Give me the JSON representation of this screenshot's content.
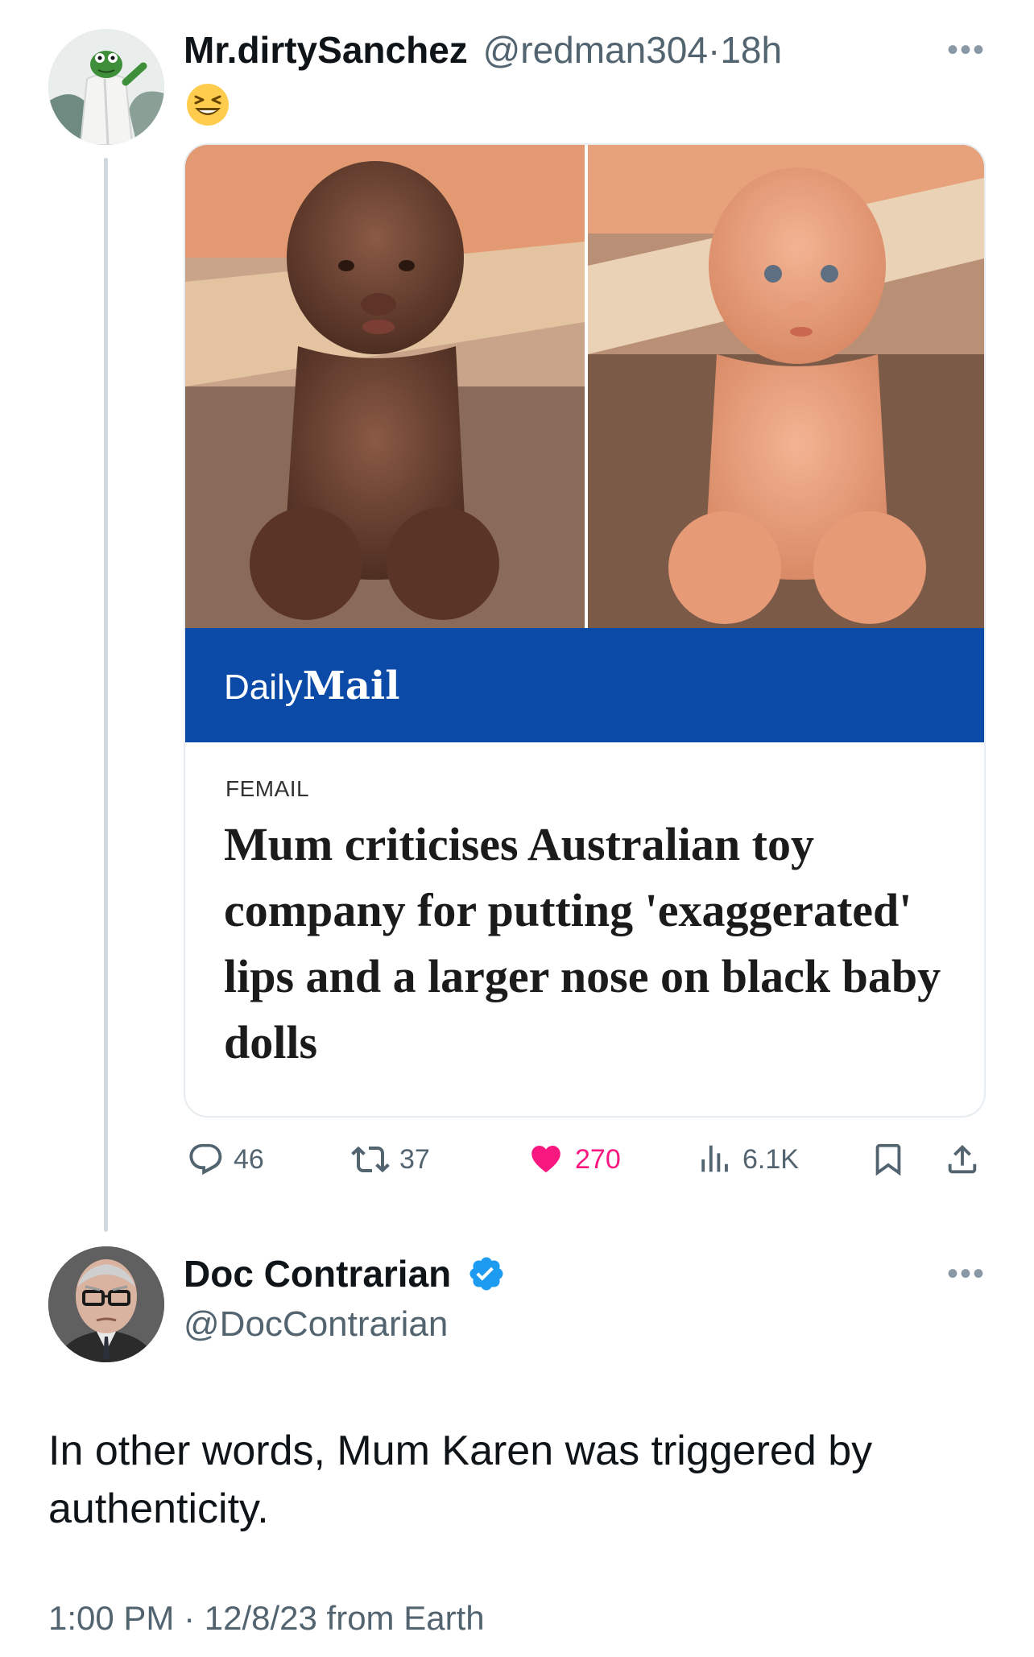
{
  "parent_tweet": {
    "display_name": "Mr.dirtySanchez",
    "handle": "@redman304",
    "separator": "·",
    "time_ago": "18h",
    "more_label": "•••",
    "emoji": "😆",
    "media": {
      "brand_daily": "Daily",
      "brand_mail": "Mail",
      "section": "FEMAIL",
      "headline": "Mum criticises Australian toy company for putting 'exaggerated' lips and a larger nose on black baby dolls"
    },
    "stats": {
      "replies": "46",
      "retweets": "37",
      "likes": "270",
      "views": "6.1K"
    }
  },
  "reply_tweet": {
    "display_name": "Doc Contrarian",
    "handle": "@DocContrarian",
    "more_label": "•••",
    "text": "In other words, Mum Karen was triggered by authenticity.",
    "meta": "1:00 PM · 12/8/23 from Earth"
  },
  "colors": {
    "like": "#f91880",
    "secondary_text": "#536471",
    "verified": "#1d9bf0",
    "daily_mail_bar": "#0b4aa7"
  },
  "icons": [
    "reply-icon",
    "retweet-icon",
    "heart-icon",
    "views-icon",
    "bookmark-icon",
    "share-icon",
    "verified-badge-icon"
  ]
}
